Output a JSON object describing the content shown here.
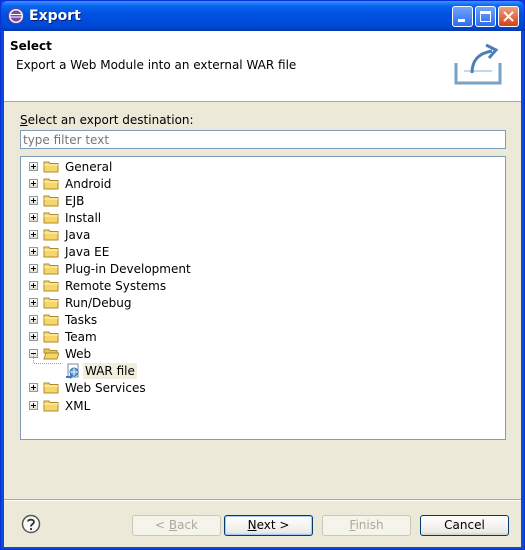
{
  "window": {
    "title": "Export"
  },
  "header": {
    "title": "Select",
    "description": "Export a Web Module into an external WAR file"
  },
  "destination": {
    "label_prefix": "",
    "label_mnemonic": "S",
    "label_rest": "elect an export destination:",
    "filter_placeholder": "type filter text"
  },
  "tree": {
    "items": [
      {
        "label": "General",
        "expanded": false
      },
      {
        "label": "Android",
        "expanded": false
      },
      {
        "label": "EJB",
        "expanded": false
      },
      {
        "label": "Install",
        "expanded": false
      },
      {
        "label": "Java",
        "expanded": false
      },
      {
        "label": "Java EE",
        "expanded": false
      },
      {
        "label": "Plug-in Development",
        "expanded": false
      },
      {
        "label": "Remote Systems",
        "expanded": false
      },
      {
        "label": "Run/Debug",
        "expanded": false
      },
      {
        "label": "Tasks",
        "expanded": false
      },
      {
        "label": "Team",
        "expanded": false
      },
      {
        "label": "Web",
        "expanded": true
      },
      {
        "label": "WAR file",
        "child": true,
        "selected": true
      },
      {
        "label": "Web Services",
        "expanded": false
      },
      {
        "label": "XML",
        "expanded": false
      }
    ]
  },
  "buttons": {
    "back_prefix": "< ",
    "back_mnemonic": "B",
    "back_rest": "ack",
    "next_mnemonic": "N",
    "next_rest": "ext >",
    "finish_mnemonic": "F",
    "finish_rest": "inish",
    "cancel": "Cancel"
  },
  "colors": {
    "title_bar": "#0054e3",
    "dialog_bg": "#ece9d8",
    "selection_bg": "#f0eedd",
    "folder": "#f5d66b"
  }
}
